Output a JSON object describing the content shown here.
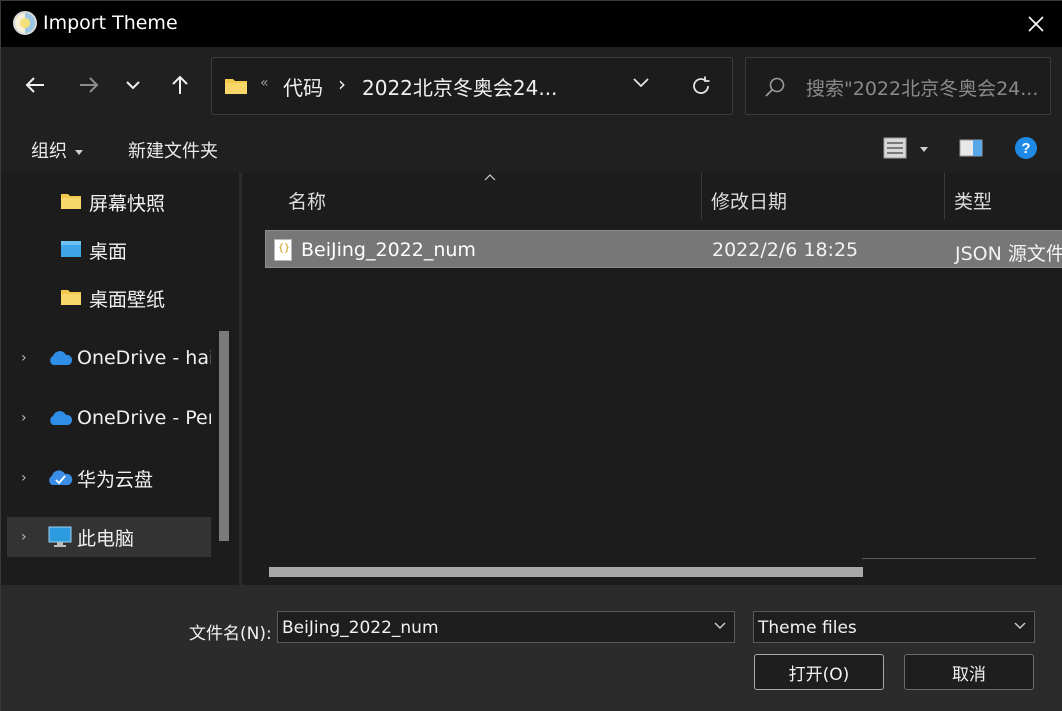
{
  "window": {
    "title": "Import Theme"
  },
  "nav": {
    "breadcrumb": [
      "代码",
      "2022北京冬奥会24..."
    ],
    "breadcrumb_overflow": "«",
    "search_placeholder": "搜索\"2022北京冬奥会24..."
  },
  "toolbar": {
    "organize": "组织",
    "new_folder": "新建文件夹"
  },
  "sidebar": {
    "items": [
      {
        "label": "屏幕快照",
        "icon": "folder-icon"
      },
      {
        "label": "桌面",
        "icon": "desktop-icon"
      },
      {
        "label": "桌面壁纸",
        "icon": "folder-icon"
      },
      {
        "label": "OneDrive - hai",
        "icon": "onedrive-icon"
      },
      {
        "label": "OneDrive - Per",
        "icon": "onedrive-icon"
      },
      {
        "label": "华为云盘",
        "icon": "huawei-cloud-icon"
      },
      {
        "label": "此电脑",
        "icon": "computer-icon",
        "selected": true
      }
    ]
  },
  "files": {
    "columns": [
      "名称",
      "修改日期",
      "类型"
    ],
    "rows": [
      {
        "name": "BeiJing_2022_num",
        "date": "2022/2/6 18:25",
        "type": "JSON 源文件"
      }
    ]
  },
  "footer": {
    "filename_label": "文件名(N):",
    "filename_value": "BeiJing_2022_num",
    "filetype_value": "Theme files",
    "open_label": "打开(O)",
    "cancel_label": "取消"
  },
  "colors": {
    "accent": "#0a84ff",
    "folder": "#f2c94c",
    "onedrive": "#2f8fe6"
  }
}
